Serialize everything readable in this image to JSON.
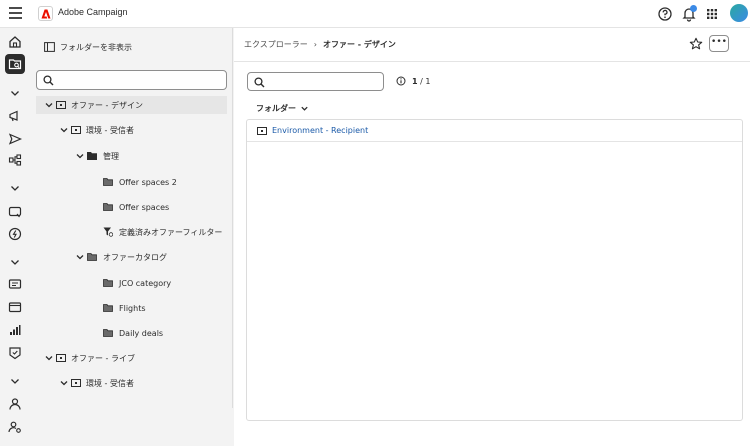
{
  "header": {
    "app_title": "Adobe Campaign",
    "brand_color": "#eb1000"
  },
  "rail": {
    "items": [
      "home-icon",
      "explorer-icon",
      "chevron-down-icon",
      "campaign-icon",
      "delivery-icon",
      "workflow-icon",
      "chevron-down-icon",
      "offer-icon",
      "decisioning-icon",
      "chevron-down-icon",
      "profiles-icon",
      "audiences-icon",
      "reports-icon",
      "badge-icon",
      "chevron-down-icon",
      "user-icon",
      "settings-icon"
    ]
  },
  "explorer": {
    "hide_label": "フォルダーを非表示",
    "tree": [
      {
        "label": "オファー - デザイン",
        "level": 0,
        "icon": "box",
        "expanded": true,
        "selected": true
      },
      {
        "label": "環境 - 受信者",
        "level": 1,
        "icon": "box",
        "expanded": true
      },
      {
        "label": "管理",
        "level": 2,
        "icon": "folder-filled",
        "expanded": true
      },
      {
        "label": "Offer spaces 2",
        "level": 3,
        "icon": "folder"
      },
      {
        "label": "Offer spaces",
        "level": 3,
        "icon": "folder"
      },
      {
        "label": "定義済みオファーフィルター",
        "level": 3,
        "icon": "filter"
      },
      {
        "label": "オファーカタログ",
        "level": 2,
        "icon": "folder",
        "expanded": true
      },
      {
        "label": "JCO category",
        "level": 3,
        "icon": "folder"
      },
      {
        "label": "Flights",
        "level": 3,
        "icon": "folder"
      },
      {
        "label": "Daily deals",
        "level": 3,
        "icon": "folder"
      },
      {
        "label": "オファー - ライブ",
        "level": 0,
        "icon": "box",
        "expanded": true
      },
      {
        "label": "環境 - 受信者",
        "level": 1,
        "icon": "box",
        "expanded": true
      }
    ]
  },
  "main": {
    "breadcrumb_root": "エクスプローラー",
    "breadcrumb_sep": "›",
    "breadcrumb_current": "オファー - デザイン",
    "more_label": "•••",
    "count_current": "1",
    "count_sep": "/",
    "count_total": "1",
    "folder_header": "フォルダー",
    "rows": [
      {
        "label": "Environment - Recipient"
      }
    ]
  }
}
